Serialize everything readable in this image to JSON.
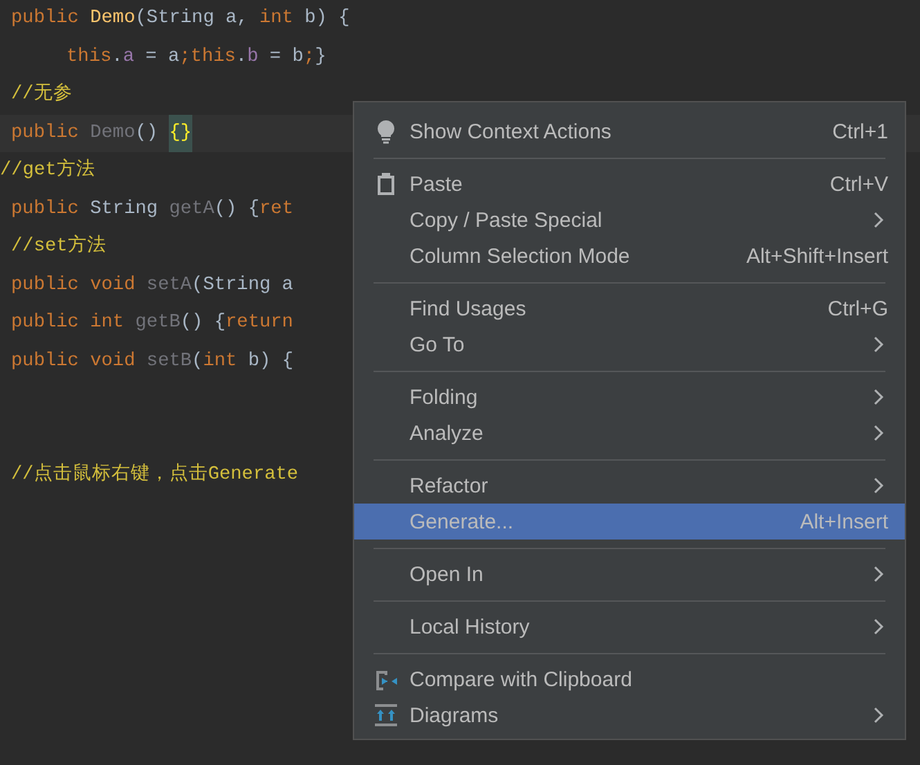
{
  "editor": {
    "lines": [
      {
        "kind": "code",
        "tokens": [
          {
            "kind": "kw",
            "text": "public "
          },
          {
            "kind": "decl",
            "text": "Demo"
          },
          {
            "kind": "plain",
            "text": "(String a, "
          },
          {
            "kind": "kw",
            "text": "int"
          },
          {
            "kind": "plain",
            "text": " b) {"
          }
        ]
      },
      {
        "kind": "nested",
        "tokens": [
          {
            "kind": "kw",
            "text": "this"
          },
          {
            "kind": "plain",
            "text": "."
          },
          {
            "kind": "field",
            "text": "a"
          },
          {
            "kind": "plain",
            "text": " = a"
          },
          {
            "kind": "kw",
            "text": ";this"
          },
          {
            "kind": "plain",
            "text": "."
          },
          {
            "kind": "field",
            "text": "b"
          },
          {
            "kind": "plain",
            "text": " = b"
          },
          {
            "kind": "kw",
            "text": ";"
          },
          {
            "kind": "plain",
            "text": "}"
          }
        ]
      },
      {
        "kind": "code",
        "tokens": [
          {
            "kind": "comment",
            "text": "//无参"
          }
        ]
      },
      {
        "kind": "current",
        "tokens": [
          {
            "kind": "kw",
            "text": "public "
          },
          {
            "kind": "unused",
            "text": "Demo"
          },
          {
            "kind": "plain",
            "text": "() "
          },
          {
            "kind": "match",
            "text": "{}"
          }
        ]
      },
      {
        "kind": "flush",
        "tokens": [
          {
            "kind": "comment",
            "text": "//get方法"
          }
        ]
      },
      {
        "kind": "code",
        "tokens": [
          {
            "kind": "kw",
            "text": "public "
          },
          {
            "kind": "plain",
            "text": "String "
          },
          {
            "kind": "unused",
            "text": "getA"
          },
          {
            "kind": "plain",
            "text": "() {"
          },
          {
            "kind": "kw",
            "text": "ret"
          }
        ]
      },
      {
        "kind": "code",
        "tokens": [
          {
            "kind": "comment",
            "text": "//set方法"
          }
        ]
      },
      {
        "kind": "code",
        "tokens": [
          {
            "kind": "kw",
            "text": "public void "
          },
          {
            "kind": "unused",
            "text": "setA"
          },
          {
            "kind": "plain",
            "text": "(String a"
          }
        ]
      },
      {
        "kind": "code",
        "tokens": [
          {
            "kind": "kw",
            "text": "public int "
          },
          {
            "kind": "unused",
            "text": "getB"
          },
          {
            "kind": "plain",
            "text": "() {"
          },
          {
            "kind": "kw",
            "text": "return"
          }
        ]
      },
      {
        "kind": "code",
        "tokens": [
          {
            "kind": "kw",
            "text": "public void "
          },
          {
            "kind": "unused",
            "text": "setB"
          },
          {
            "kind": "plain",
            "text": "("
          },
          {
            "kind": "kw",
            "text": "int"
          },
          {
            "kind": "plain",
            "text": " b) {"
          }
        ]
      },
      {
        "kind": "blank"
      },
      {
        "kind": "blank"
      },
      {
        "kind": "code",
        "tokens": [
          {
            "kind": "comment",
            "text": "//点击鼠标右键，点击Generate"
          }
        ]
      }
    ]
  },
  "context_menu": {
    "items": [
      {
        "kind": "item",
        "label": "Show Context Actions",
        "shortcut": "Ctrl+1",
        "submenu": false,
        "selected": false
      },
      {
        "kind": "separator"
      },
      {
        "kind": "item",
        "label": "Paste",
        "shortcut": "Ctrl+V",
        "submenu": false,
        "selected": false
      },
      {
        "kind": "item",
        "label": "Copy / Paste Special",
        "submenu": true,
        "selected": false
      },
      {
        "kind": "item",
        "label": "Column Selection Mode",
        "shortcut": "Alt+Shift+Insert",
        "submenu": false,
        "selected": false
      },
      {
        "kind": "separator"
      },
      {
        "kind": "item",
        "label": "Find Usages",
        "shortcut": "Ctrl+G",
        "submenu": false,
        "selected": false
      },
      {
        "kind": "item",
        "label": "Go To",
        "submenu": true,
        "selected": false
      },
      {
        "kind": "separator"
      },
      {
        "kind": "item",
        "label": "Folding",
        "submenu": true,
        "selected": false
      },
      {
        "kind": "item",
        "label": "Analyze",
        "submenu": true,
        "selected": false
      },
      {
        "kind": "separator"
      },
      {
        "kind": "item",
        "label": "Refactor",
        "submenu": true,
        "selected": false
      },
      {
        "kind": "item",
        "label": "Generate...",
        "shortcut": "Alt+Insert",
        "submenu": false,
        "selected": true
      },
      {
        "kind": "separator"
      },
      {
        "kind": "item",
        "label": "Open In",
        "submenu": true,
        "selected": false
      },
      {
        "kind": "separator"
      },
      {
        "kind": "item",
        "label": "Local History",
        "submenu": true,
        "selected": false
      },
      {
        "kind": "separator"
      },
      {
        "kind": "item",
        "label": "Compare with Clipboard",
        "submenu": false,
        "selected": false
      },
      {
        "kind": "item",
        "label": "Diagrams",
        "submenu": true,
        "selected": false
      }
    ]
  }
}
